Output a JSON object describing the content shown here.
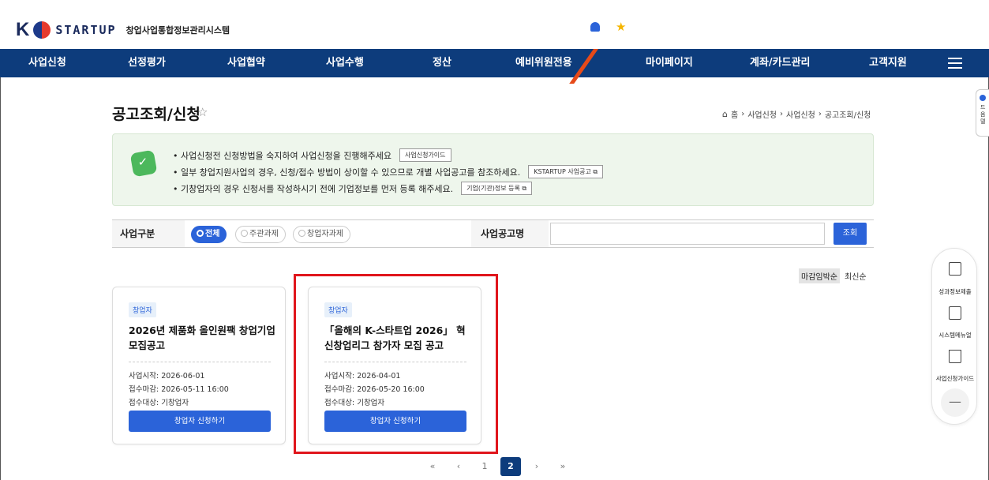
{
  "header": {
    "logo_k": "K",
    "logo_text": "STARTUP",
    "logo_sub": "창업사업통합정보관리시스템"
  },
  "nav": {
    "items": [
      "사업신청",
      "선정평가",
      "사업협약",
      "사업수행",
      "정산",
      "예비위원전용",
      "마이페이지",
      "계좌/카드관리",
      "고객지원"
    ]
  },
  "page": {
    "title": "공고조회/신청",
    "breadcrumb": [
      "홈",
      "사업신청",
      "사업신청",
      "공고조회/신청"
    ]
  },
  "notice": {
    "lines": [
      {
        "text": "• 사업신청전 신청방법을 숙지하여 사업신청을 진행해주세요",
        "button": "사업신청가이드"
      },
      {
        "text": "• 일부 창업지원사업의 경우, 신청/접수 방법이 상이할 수 있으므로 개별 사업공고를 참조하세요.",
        "button": "KSTARTUP 사업공고 ⧉"
      },
      {
        "text": "• 기창업자의 경우 신청서를 작성하시기 전에 기업정보를 먼저 등록 해주세요.",
        "button": "기업(기관)정보 등록 ⧉"
      }
    ]
  },
  "filter": {
    "category_label": "사업구분",
    "options": [
      "전체",
      "주관과제",
      "창업자과제"
    ],
    "selected": "전체",
    "name_label": "사업공고명",
    "search_value": "",
    "search_button": "조회"
  },
  "sort": {
    "active": "마감임박순",
    "other": "최신순"
  },
  "cards": [
    {
      "badge": "창업자",
      "title": "2026년 제품화 올인원팩 창업기업 모집공고",
      "start_label": "사업시작:",
      "start": "2026-06-01",
      "deadline_label": "접수마감:",
      "deadline": "2026-05-11 16:00",
      "target_label": "접수대상:",
      "target": "기창업자",
      "apply": "창업자 신청하기"
    },
    {
      "badge": "창업자",
      "title": "「올해의 K-스타트업 2026」 혁신창업리그 참가자 모집 공고",
      "start_label": "사업시작:",
      "start": "2026-04-01",
      "deadline_label": "접수마감:",
      "deadline": "2026-05-20 16:00",
      "target_label": "접수대상:",
      "target": "기창업자",
      "apply": "창업자 신청하기"
    }
  ],
  "pagination": {
    "first": "«",
    "prev": "‹",
    "pages": [
      "1",
      "2"
    ],
    "current": "2",
    "next": "›",
    "last": "»"
  },
  "side_panel": {
    "items": [
      "성과정보제출",
      "시스템메뉴얼",
      "사업신청가이드"
    ],
    "collapse": "—"
  },
  "edge_tab": {
    "text": "드음델"
  },
  "colors": {
    "nav_bg": "#0d3c7c",
    "primary": "#2b63d9",
    "highlight": "#e0161c",
    "notice_bg": "#eef6ec"
  }
}
